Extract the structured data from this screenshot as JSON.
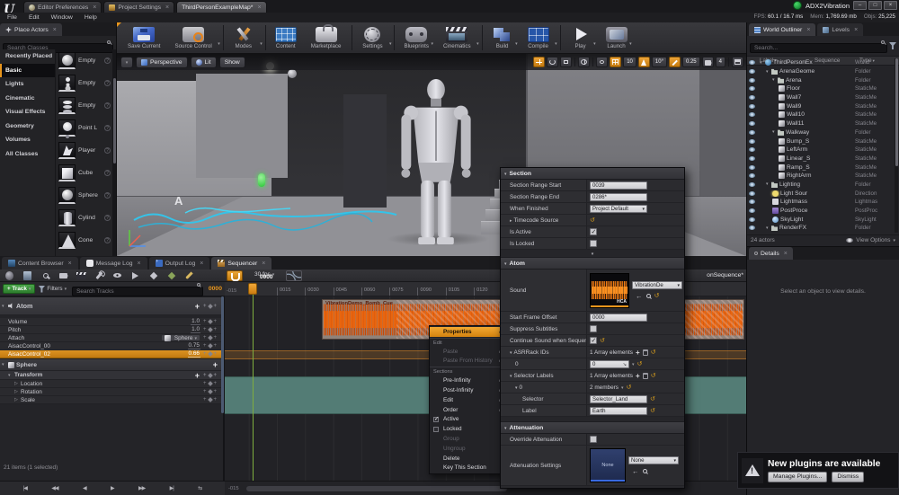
{
  "window": {
    "logo": "U",
    "tabs": [
      {
        "label": "Editor Preferences",
        "icon": "prefs"
      },
      {
        "label": "Project Settings",
        "icon": "proj"
      },
      {
        "label": "ThirdPersonExampleMap*",
        "active": true
      }
    ],
    "title": "ADX2Vibration",
    "window_buttons": [
      {
        "name": "minimize-button",
        "glyph": "–"
      },
      {
        "name": "maximize-button",
        "glyph": "□"
      },
      {
        "name": "close-button",
        "glyph": "×"
      }
    ],
    "menus": [
      {
        "label": "File"
      },
      {
        "label": "Edit"
      },
      {
        "label": "Window"
      },
      {
        "label": "Help"
      }
    ],
    "stats": [
      {
        "label": "FPS:",
        "value": "60.1 / 16.7 ms"
      },
      {
        "label": "Mem:",
        "value": "1,769.69 mb"
      },
      {
        "label": "Objs:",
        "value": "25,225"
      }
    ]
  },
  "toolbar": {
    "buttons": [
      {
        "label": "Save Current",
        "icon": "save"
      },
      {
        "label": "Source Control",
        "icon": "sc",
        "caret": true,
        "sep": true
      },
      {
        "label": "Modes",
        "icon": "modes",
        "caret": true,
        "sep": true
      },
      {
        "label": "Content",
        "icon": "content"
      },
      {
        "label": "Marketplace",
        "icon": "market",
        "sep": true
      },
      {
        "label": "Settings",
        "icon": "settings",
        "caret": true,
        "sep": true
      },
      {
        "label": "Blueprints",
        "icon": "bp",
        "caret": true
      },
      {
        "label": "Cinematics",
        "icon": "cine",
        "caret": true,
        "sep": true
      },
      {
        "label": "Build",
        "icon": "build",
        "caret": true
      },
      {
        "label": "Compile",
        "icon": "compile",
        "caret": true,
        "sep": true
      },
      {
        "label": "Play",
        "icon": "play",
        "caret": true
      },
      {
        "label": "Launch",
        "icon": "launch",
        "caret": true
      }
    ]
  },
  "place_actors": {
    "tab": "Place Actors",
    "search_placeholder": "Search Classes",
    "categories": [
      {
        "label": "Recently Placed"
      },
      {
        "label": "Basic",
        "active": true
      },
      {
        "label": "Lights"
      },
      {
        "label": "Cinematic"
      },
      {
        "label": "Visual Effects"
      },
      {
        "label": "Geometry"
      },
      {
        "label": "Volumes"
      },
      {
        "label": "All Classes"
      }
    ],
    "items": [
      {
        "label": "Empty",
        "icon": "ball"
      },
      {
        "label": "Empty",
        "icon": "figure"
      },
      {
        "label": "Empty",
        "icon": "stack"
      },
      {
        "label": "Point L",
        "icon": "bulb"
      },
      {
        "label": "Player",
        "icon": "player"
      },
      {
        "label": "Cube",
        "icon": "cube"
      },
      {
        "label": "Sphere",
        "icon": "ballb"
      },
      {
        "label": "Cylind",
        "icon": "cyl"
      },
      {
        "label": "Cone",
        "icon": "cone"
      }
    ]
  },
  "viewport": {
    "mode_buttons": [
      {
        "label": "Perspective",
        "icon": "persp"
      },
      {
        "label": "Lit",
        "icon": "lit"
      },
      {
        "label": "Show"
      }
    ],
    "grid_snap": "10",
    "rot_snap": "10°",
    "scale_snap": "0.25",
    "cam_speed": "4",
    "scene_label": "A"
  },
  "outliner": {
    "tabs": [
      {
        "label": "World Outliner",
        "icon": "wot",
        "active": true
      },
      {
        "label": "Levels",
        "icon": "lvl"
      }
    ],
    "search_placeholder": "Search...",
    "columns": {
      "label": "Label",
      "sequence": "Sequence",
      "type": "Type"
    },
    "rows": [
      {
        "label": "ThirdPersonEx",
        "type": "World",
        "indent": 0,
        "icon": "world",
        "expander": "▾"
      },
      {
        "label": "ArenaGeome",
        "type": "Folder",
        "indent": 1,
        "icon": "folder",
        "expander": "▾"
      },
      {
        "label": "Arena",
        "type": "Folder",
        "indent": 2,
        "icon": "folder",
        "expander": "▾"
      },
      {
        "label": "Floor",
        "type": "StaticMe",
        "indent": 3,
        "icon": "mesh"
      },
      {
        "label": "Wall7",
        "type": "StaticMe",
        "indent": 3,
        "icon": "mesh"
      },
      {
        "label": "Wall9",
        "type": "StaticMe",
        "indent": 3,
        "icon": "mesh"
      },
      {
        "label": "Wall10",
        "type": "StaticMe",
        "indent": 3,
        "icon": "mesh"
      },
      {
        "label": "Wall11",
        "type": "StaticMe",
        "indent": 3,
        "icon": "mesh"
      },
      {
        "label": "Walkway",
        "type": "Folder",
        "indent": 2,
        "icon": "folder",
        "expander": "▾"
      },
      {
        "label": "Bump_S",
        "type": "StaticMe",
        "indent": 3,
        "icon": "mesh"
      },
      {
        "label": "LeftArm",
        "type": "StaticMe",
        "indent": 3,
        "icon": "mesh"
      },
      {
        "label": "Linear_S",
        "type": "StaticMe",
        "indent": 3,
        "icon": "mesh"
      },
      {
        "label": "Ramp_S",
        "type": "StaticMe",
        "indent": 3,
        "icon": "mesh"
      },
      {
        "label": "RightArm",
        "type": "StaticMe",
        "indent": 3,
        "icon": "mesh"
      },
      {
        "label": "Lighting",
        "type": "Folder",
        "indent": 1,
        "icon": "folder",
        "expander": "▾"
      },
      {
        "label": "Light Sour",
        "type": "Direction",
        "indent": 2,
        "icon": "light"
      },
      {
        "label": "Lightmass",
        "type": "Lightmas",
        "indent": 2,
        "icon": "lightmass"
      },
      {
        "label": "PostProce",
        "type": "PostProc",
        "indent": 2,
        "icon": "postprocess"
      },
      {
        "label": "SkyLight",
        "type": "SkyLight",
        "indent": 2,
        "icon": "skylight"
      },
      {
        "label": "RenderFX",
        "type": "Folder",
        "indent": 1,
        "icon": "folder",
        "expander": "▾"
      }
    ],
    "footer_count": "24 actors",
    "view_options": "View Options"
  },
  "details": {
    "tab": "Details",
    "empty": "Select an object to view details."
  },
  "bottom_tabs": [
    {
      "label": "Content Browser",
      "icon": "cbt"
    },
    {
      "label": "Message Log",
      "icon": "mlt"
    },
    {
      "label": "Output Log",
      "icon": "olt"
    },
    {
      "label": "Sequencer",
      "icon": "sqt",
      "active": true
    }
  ],
  "sequencer": {
    "toolbar_icons": [
      {
        "name": "sequence-options-icon",
        "shape": "ball2",
        "caret": true
      },
      {
        "name": "save-sequence-icon",
        "shape": "floppy"
      },
      {
        "name": "find-in-content-browser-icon",
        "shape": "mag"
      },
      {
        "name": "create-camera-icon",
        "shape": "cam2"
      },
      {
        "name": "render-movie-icon",
        "shape": "clap"
      },
      {
        "name": "actions-icon",
        "shape": "wrench",
        "caret": true
      },
      {
        "name": "view-options-icon",
        "shape": "eye2",
        "caret": true
      },
      {
        "name": "playback-options-icon",
        "shape": "play2",
        "caret": true
      },
      {
        "name": "keyframe-options-icon",
        "shape": "diamond",
        "caret": true
      },
      {
        "name": "auto-keyframe-icon",
        "shape": "diamond2"
      },
      {
        "name": "edit-options-icon",
        "shape": "pen",
        "caret": true
      }
    ],
    "fps_label": "30 fps",
    "breadcrumb_partial": "onSequence*",
    "add_track_label": "+ Track",
    "filters_label": "Filters",
    "search_placeholder": "Search Tracks",
    "current_time": "0000",
    "playhead_label": "0000",
    "ruler_neg": "-015",
    "ruler_ticks": [
      "0015",
      "0030",
      "0045",
      "0060",
      "0075",
      "0090",
      "0105",
      "0120"
    ],
    "clip_label": "VibrationDemo_Bomb_Cue",
    "tracks": [
      {
        "label": "Atom",
        "kind": "group",
        "icon": "speaker",
        "expander": "▾",
        "add": true,
        "keys": true
      },
      {
        "label": "Volume",
        "value": "1.0",
        "indent": 1,
        "keys": true
      },
      {
        "label": "Pitch",
        "value": "1.0",
        "indent": 1,
        "keys": true
      },
      {
        "label": "Attach",
        "indent": 1,
        "dropdown": {
          "label": "Sphere"
        },
        "keys": true
      },
      {
        "label": "AisacControl_00",
        "value": "0.75",
        "indent": 1,
        "keys": true
      },
      {
        "label": "AisacControl_02",
        "value": "0.66",
        "indent": 1,
        "keys": true,
        "state": "selected"
      },
      {
        "label": "Sphere",
        "kind": "group2",
        "icon": "mesh",
        "expander": "▾",
        "add": true
      },
      {
        "label": "Transform",
        "kind": "subgroup",
        "indent": 1,
        "expander": "▾",
        "add": true,
        "keys": true
      },
      {
        "label": "Location",
        "indent": 2,
        "expander": "▷",
        "keys": true
      },
      {
        "label": "Rotation",
        "indent": 2,
        "expander": "▷",
        "keys": true
      },
      {
        "label": "Scale",
        "indent": 2,
        "expander": "▷",
        "keys": true
      }
    ],
    "status": "21 items (1 selected)",
    "bottom_range_start": "-015",
    "transport": [
      {
        "name": "go-to-front-button",
        "glyph": "|◀"
      },
      {
        "name": "step-back-button",
        "glyph": "◀◀"
      },
      {
        "name": "play-reverse-button",
        "glyph": "◀"
      },
      {
        "name": "play-button",
        "glyph": "▶"
      },
      {
        "name": "step-forward-button",
        "glyph": "▶▶"
      },
      {
        "name": "go-to-end-button",
        "glyph": "▶|"
      },
      {
        "name": "loop-button",
        "glyph": "⇆"
      }
    ]
  },
  "context_menu": {
    "items": [
      {
        "label": "Properties",
        "kind": "item",
        "state": "highlight",
        "arrow": true
      },
      {
        "label": "Edit",
        "kind": "header"
      },
      {
        "label": "Paste",
        "kind": "item",
        "state": "disabled",
        "arrow": true
      },
      {
        "label": "Paste From History",
        "kind": "item",
        "state": "disabled",
        "arrow": true
      },
      {
        "label": "Sections",
        "kind": "header"
      },
      {
        "label": "Pre-Infinity",
        "kind": "item",
        "arrow": true
      },
      {
        "label": "Post-Infinity",
        "kind": "item",
        "arrow": true
      },
      {
        "label": "Edit",
        "kind": "item",
        "arrow": true
      },
      {
        "label": "Order",
        "kind": "item",
        "arrow": true
      },
      {
        "label": "Active",
        "kind": "item",
        "check": "checked"
      },
      {
        "label": "Locked",
        "kind": "item",
        "check": "unchecked"
      },
      {
        "label": "Group",
        "kind": "item",
        "state": "disabled"
      },
      {
        "label": "Ungroup",
        "kind": "item",
        "state": "disabled"
      },
      {
        "label": "Delete",
        "kind": "item"
      },
      {
        "label": "Key This Section",
        "kind": "item"
      }
    ]
  },
  "props": {
    "section": {
      "title": "Section",
      "range_start_label": "Section Range Start",
      "range_start": "0039",
      "range_end_label": "Section Range End",
      "range_end": "0286*",
      "when_finished_label": "When Finished",
      "when_finished": "Project Default",
      "timecode_label": "Timecode Source",
      "is_active_label": "Is Active",
      "is_locked_label": "Is Locked"
    },
    "atom": {
      "title": "Atom",
      "sound_label": "Sound",
      "sound_asset": "VibrationDe",
      "sound_format": "HCA",
      "start_frame_label": "Start Frame Offset",
      "start_frame": "0000",
      "suppress_label": "Suppress Subtitles",
      "continue_label": "Continue Sound when Sequence Is End",
      "asrrack_label": "ASRRack IDs",
      "asrrack_value": "1 Array elements",
      "asrrack_item_label": "0",
      "asrrack_item_value": "0",
      "selector_labels_label": "Selector Labels",
      "selector_labels_value": "1 Array elements",
      "selector_item_label": "0",
      "selector_item_value": "2 members",
      "selector_label": "Selector",
      "selector_value": "Selector_Land",
      "label_label": "Label",
      "label_value": "Earth"
    },
    "attenuation": {
      "title": "Attenuation",
      "override_label": "Override Attenuation",
      "settings_label": "Attenuation Settings",
      "settings_value": "None",
      "settings_thumb": "None"
    }
  },
  "notification": {
    "title": "New plugins are available",
    "buttons": [
      {
        "label": "Manage Plugins..."
      },
      {
        "label": "Dismiss"
      }
    ]
  }
}
